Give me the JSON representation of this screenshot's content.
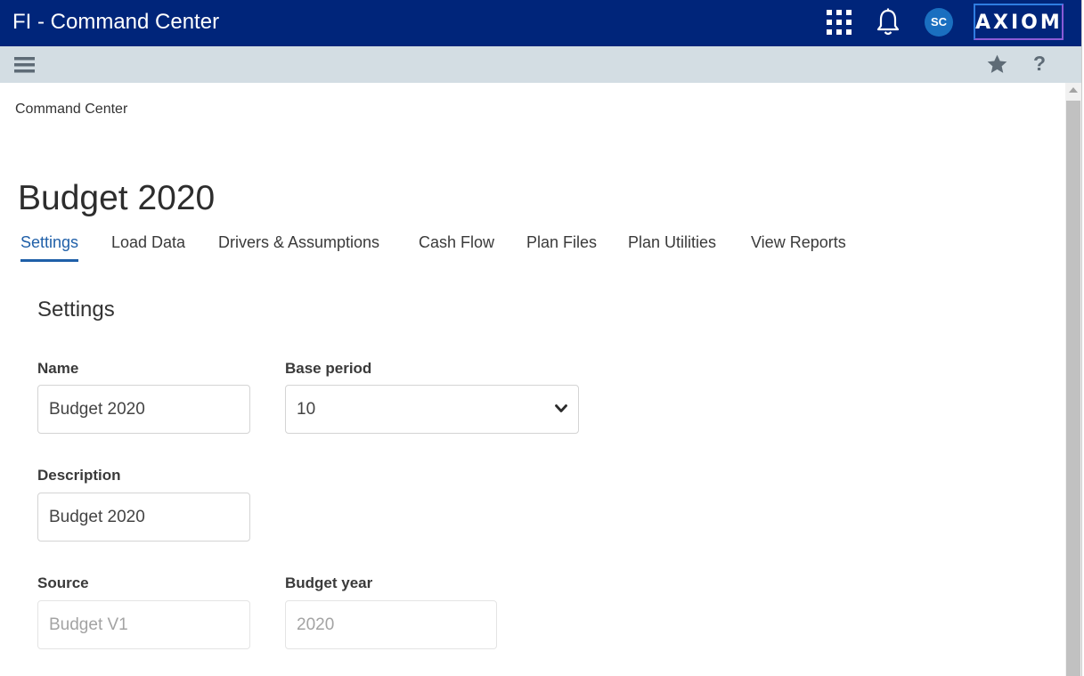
{
  "header": {
    "app_title": "FI - Command Center",
    "avatar_initials": "SC",
    "logo_text": "AXIOM",
    "brand_color": "#00257a"
  },
  "toolbar": {
    "help_label": "?"
  },
  "breadcrumb": "Command Center",
  "page_title": "Budget 2020",
  "tabs": [
    {
      "label": "Settings",
      "active": true
    },
    {
      "label": "Load Data"
    },
    {
      "label": "Drivers & Assumptions"
    },
    {
      "label": "Cash Flow"
    },
    {
      "label": "Plan Files"
    },
    {
      "label": "Plan Utilities"
    },
    {
      "label": "View Reports"
    }
  ],
  "settings": {
    "section_title": "Settings",
    "name": {
      "label": "Name",
      "value": "Budget 2020"
    },
    "base_period": {
      "label": "Base period",
      "value": "10"
    },
    "description": {
      "label": "Description",
      "value": "Budget 2020"
    },
    "source": {
      "label": "Source",
      "value": "Budget V1"
    },
    "budget_year": {
      "label": "Budget year",
      "value": "2020"
    }
  }
}
